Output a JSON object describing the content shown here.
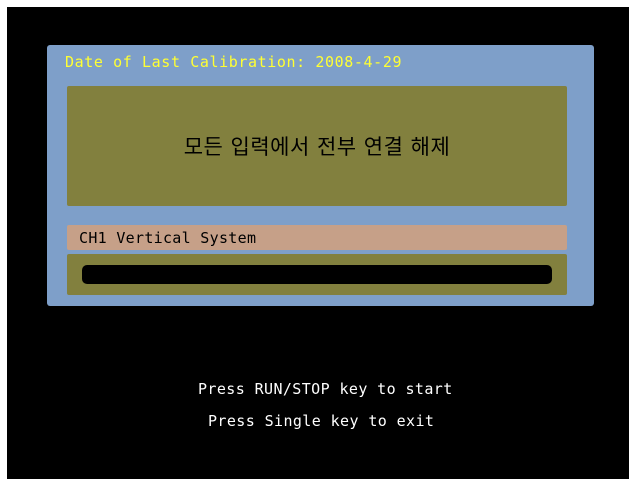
{
  "calibration": {
    "title": "Date of Last Calibration: 2008-4-29"
  },
  "message": {
    "text": "모든 입력에서 전부 연결 해제"
  },
  "channel": {
    "label": "CH1 Vertical System"
  },
  "progress": {
    "value": 0
  },
  "instructions": {
    "line1": "Press RUN/STOP key to start",
    "line2": "Press Single key to exit"
  },
  "colors": {
    "screen_bg": "#000000",
    "dialog_bg": "#7e9fc9",
    "panel_bg": "#82803e",
    "channel_bg": "#c6a088",
    "title_text": "#ffff33",
    "instruction_text": "#ffffff"
  }
}
